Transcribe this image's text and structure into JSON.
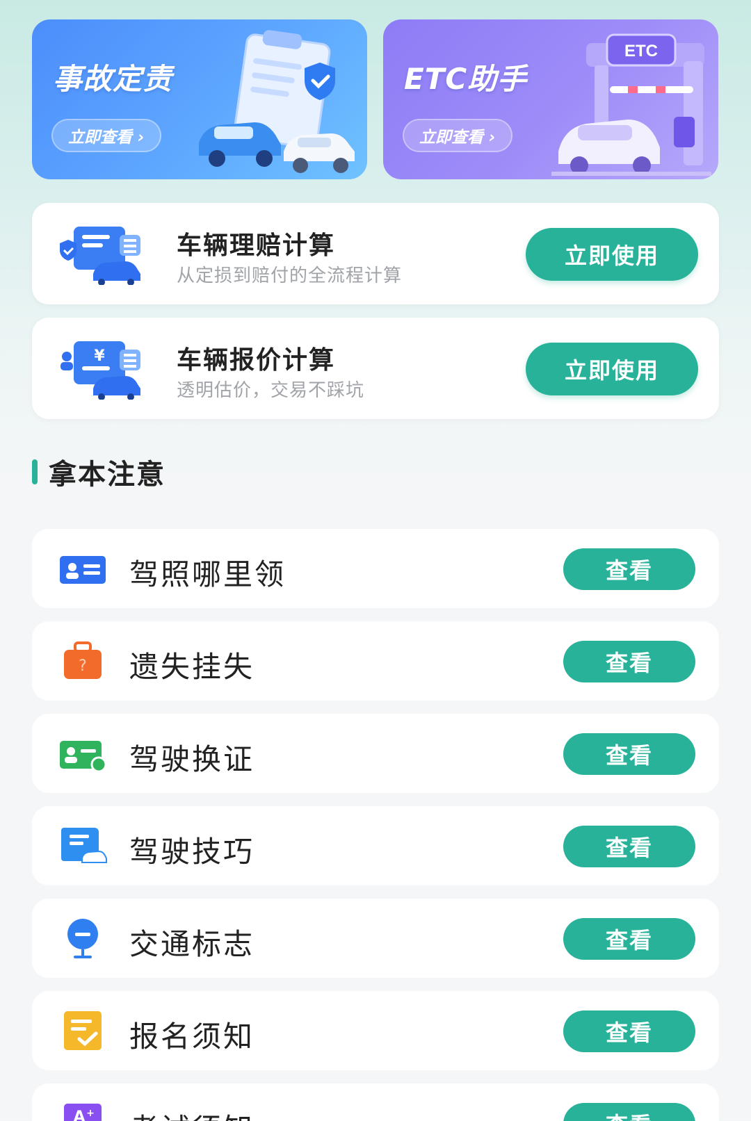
{
  "banners": [
    {
      "title": "事故定责",
      "cta": "立即查看 ›"
    },
    {
      "title": "ETC助手",
      "cta": "立即查看 ›",
      "badge": "ETC"
    }
  ],
  "tools": [
    {
      "title": "车辆理赔计算",
      "subtitle": "从定损到赔付的全流程计算",
      "button": "立即使用"
    },
    {
      "title": "车辆报价计算",
      "subtitle": "透明估价，交易不踩坑",
      "button": "立即使用",
      "currency_symbol": "¥"
    }
  ],
  "section": {
    "title": "拿本注意"
  },
  "notices": [
    {
      "label": "驾照哪里领",
      "button": "查看",
      "icon": "license-card-icon",
      "color": "#2f6ff0"
    },
    {
      "label": "遗失挂失",
      "button": "查看",
      "icon": "lost-bag-icon",
      "color": "#f26b2a"
    },
    {
      "label": "驾驶换证",
      "button": "查看",
      "icon": "renew-card-icon",
      "color": "#2fb35c"
    },
    {
      "label": "驾驶技巧",
      "button": "查看",
      "icon": "driving-tips-icon",
      "color": "#2f8ff0"
    },
    {
      "label": "交通标志",
      "button": "查看",
      "icon": "traffic-sign-icon",
      "color": "#2f7ff0"
    },
    {
      "label": "报名须知",
      "button": "查看",
      "icon": "registration-note-icon",
      "color": "#f5b82a"
    },
    {
      "label": "考试须知",
      "button": "查看",
      "icon": "exam-note-icon",
      "color": "#8a4ff0"
    }
  ],
  "colors": {
    "accent": "#27b299"
  }
}
